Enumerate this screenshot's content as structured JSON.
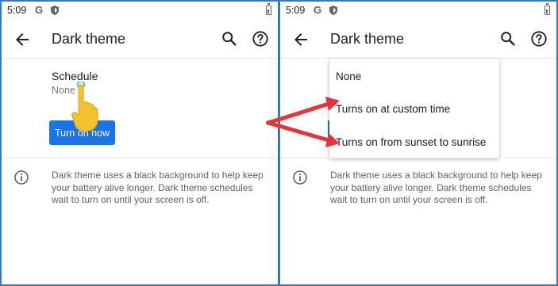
{
  "left": {
    "status": {
      "time": "5:09",
      "g": "G"
    },
    "appbar": {
      "title": "Dark theme"
    },
    "schedule": {
      "label": "Schedule",
      "value": "None"
    },
    "turn_on_button": "Turn on now",
    "info": "Dark theme uses a black background to help keep your battery alive longer. Dark theme schedules wait to turn on until your screen is off."
  },
  "right": {
    "status": {
      "time": "5:09",
      "g": "G"
    },
    "appbar": {
      "title": "Dark theme"
    },
    "menu": [
      "None",
      "Turns on at custom time",
      "Turns on from sunset to sunrise"
    ],
    "info": "Dark theme uses a black background to help keep your battery alive longer. Dark theme schedules wait to turn on until your screen is off."
  },
  "icons": [
    "back-arrow-icon",
    "search-icon",
    "help-icon",
    "info-icon",
    "shield-icon",
    "battery-icon",
    "pointing-hand-icon",
    "red-arrow-icon"
  ],
  "colors": {
    "accent": "#1a73e8",
    "frame": "#3a78b8",
    "annotation": "#e8333a",
    "hand": "#f2c12e"
  }
}
